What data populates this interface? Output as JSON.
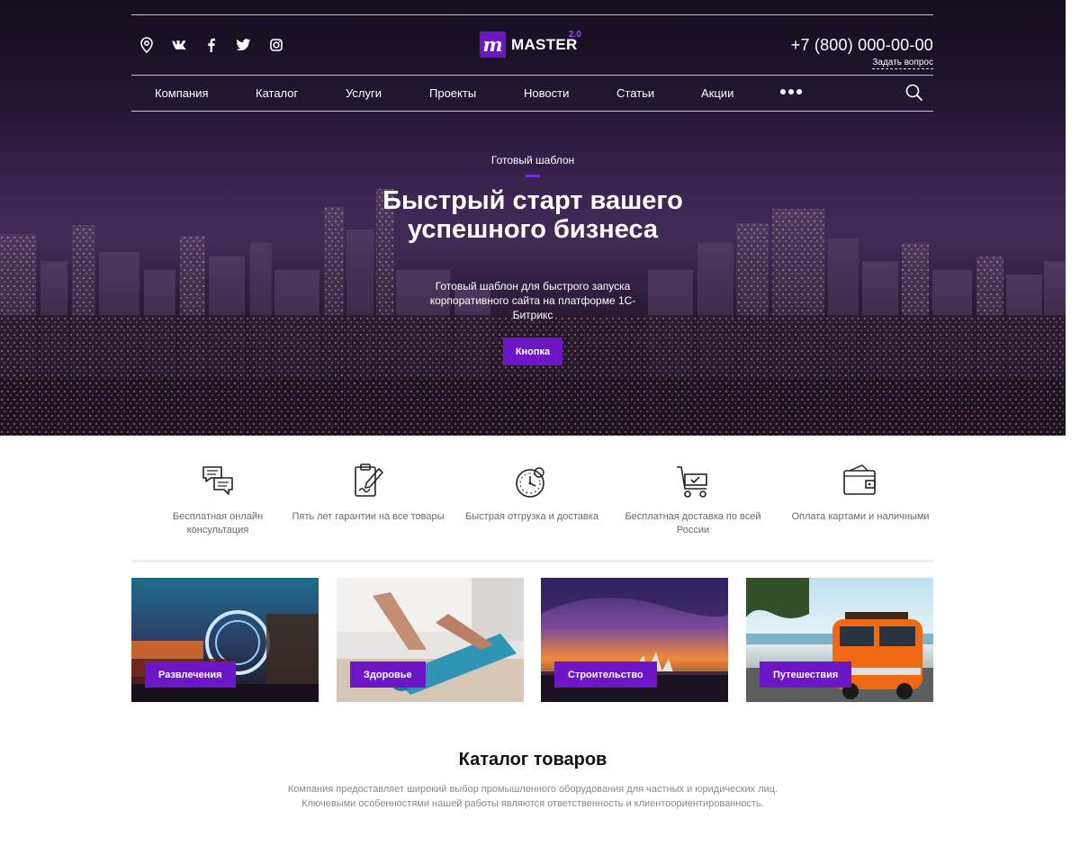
{
  "brand": {
    "logo_letter": "m",
    "name": "MASTER",
    "version": "2.0",
    "accent": "#6d16c7"
  },
  "header": {
    "social": [
      "location-icon",
      "vk-icon",
      "facebook-icon",
      "twitter-icon",
      "instagram-icon"
    ],
    "phone": "+7 (800) 000-00-00",
    "ask_link": "Задать вопрос"
  },
  "nav": {
    "items": [
      "Компания",
      "Каталог",
      "Услуги",
      "Проекты",
      "Новости",
      "Статьи",
      "Акции"
    ],
    "more_icon": "more-dots-icon",
    "search_icon": "search-icon"
  },
  "hero": {
    "eyebrow": "Готовый шаблон",
    "title": "Быстрый старт вашего успешного бизнеса",
    "subtitle": "Готовый шаблон для быстрого запуска корпоративного сайта на платформе 1С-Битрикс",
    "button": "Кнопка"
  },
  "features": [
    {
      "icon": "chat-icon",
      "text": "Бесплатная онлайн консультация"
    },
    {
      "icon": "clipboard-pen-icon",
      "text": "Пять лет гарантии на все товары"
    },
    {
      "icon": "stopwatch-icon",
      "text": "Быстрая отгрузка и доставка"
    },
    {
      "icon": "cart-icon",
      "text": "Бесплатная доставка по всей России"
    },
    {
      "icon": "wallet-icon",
      "text": "Оплата картами и наличными"
    }
  ],
  "categories": [
    {
      "label": "Развлечения"
    },
    {
      "label": "Здоровье"
    },
    {
      "label": "Строительство"
    },
    {
      "label": "Путешествия"
    }
  ],
  "catalog": {
    "title": "Каталог товаров",
    "text": "Компания предоставляет широкий выбор промышленного оборудования для частных и юридических лиц. Ключевыми особенностями нашей работы являются ответственность и клиентоориентированность."
  }
}
